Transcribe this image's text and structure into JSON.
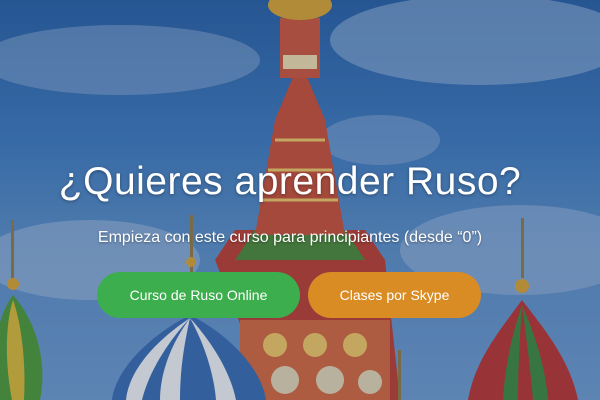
{
  "hero": {
    "headline": "¿Quieres aprender Ruso?",
    "subheadline": "Empieza con este curso para principiantes (desde “0”)"
  },
  "buttons": {
    "online_label": "Curso de Ruso Online",
    "skype_label": "Clases por Skype"
  },
  "colors": {
    "online_button": "#3cae4d",
    "skype_button": "#d98b24",
    "sky": "#3f7cc0"
  }
}
